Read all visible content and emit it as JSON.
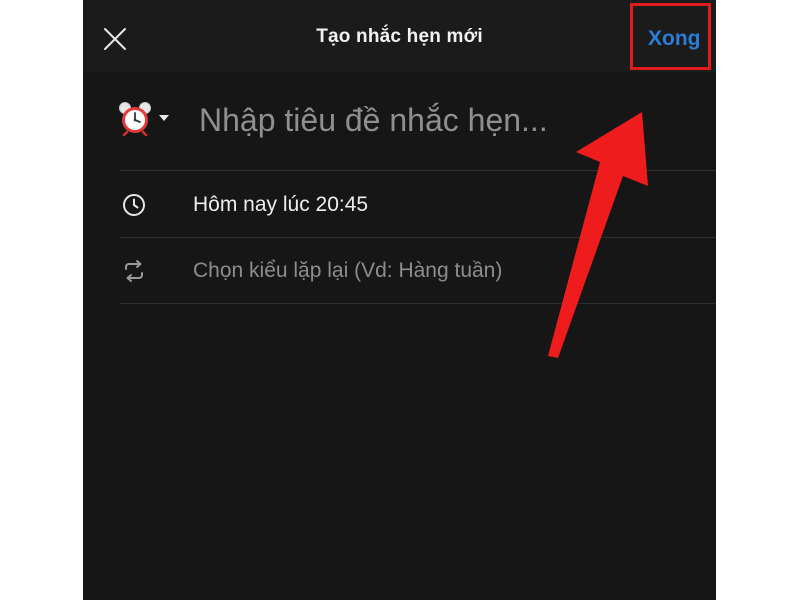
{
  "header": {
    "title": "Tạo nhắc hẹn mới",
    "done_label": "Xong",
    "close_icon": "close-icon"
  },
  "title_input": {
    "placeholder": "Nhập tiêu đề nhắc hẹn...",
    "value": "",
    "emoji": "⏰",
    "emoji_icon": "alarm-clock-icon"
  },
  "rows": [
    {
      "icon": "clock-icon",
      "text": "Hôm nay lúc 20:45"
    },
    {
      "icon": "repeat-icon",
      "text": "Chọn kiểu lặp lại (Vd: Hàng tuần)"
    }
  ],
  "colors": {
    "background": "#161616",
    "header": "#1b1b1b",
    "accent": "#2b7dd6",
    "annotation": "#e31b1b"
  }
}
